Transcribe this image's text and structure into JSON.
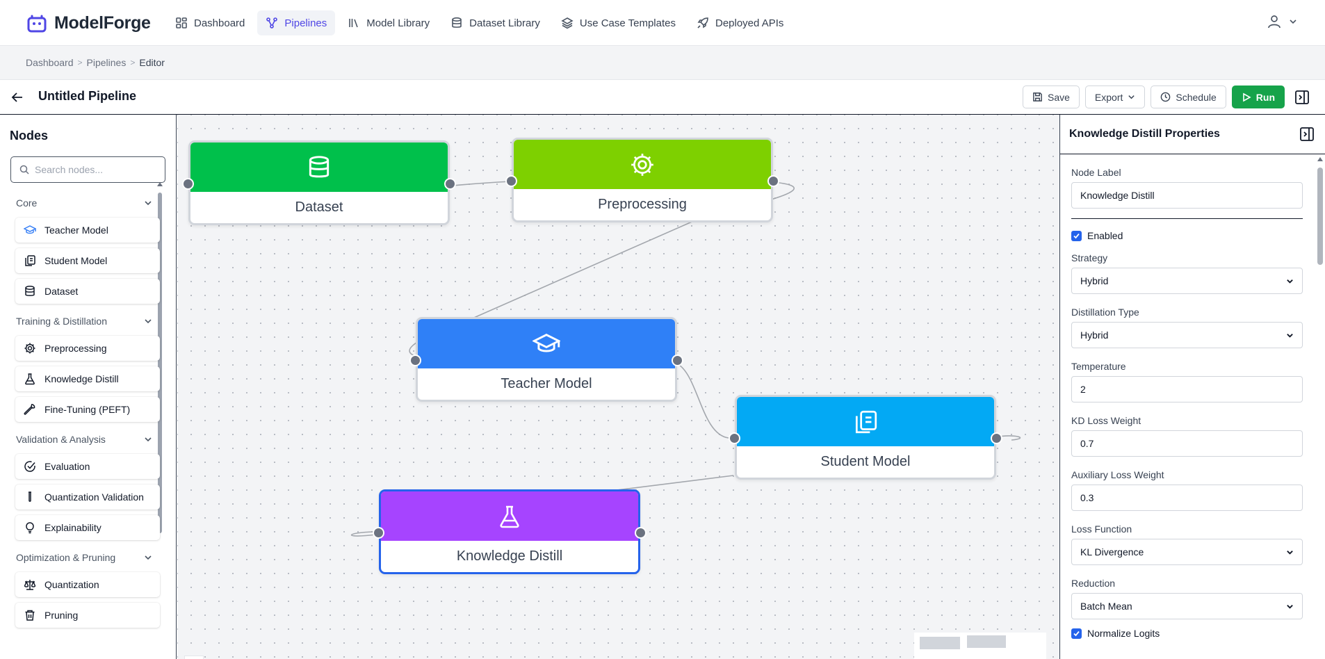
{
  "app": {
    "name": "ModelForge"
  },
  "nav": [
    {
      "label": "Dashboard",
      "icon": "grid-icon"
    },
    {
      "label": "Pipelines",
      "icon": "pipeline-icon",
      "active": true
    },
    {
      "label": "Model Library",
      "icon": "library-icon"
    },
    {
      "label": "Dataset Library",
      "icon": "database-icon"
    },
    {
      "label": "Use Case Templates",
      "icon": "layers-icon"
    },
    {
      "label": "Deployed APIs",
      "icon": "rocket-icon"
    }
  ],
  "breadcrumb": [
    "Dashboard",
    "Pipelines",
    "Editor"
  ],
  "toolbar": {
    "title": "Untitled Pipeline",
    "save": "Save",
    "export": "Export",
    "schedule": "Schedule",
    "run": "Run"
  },
  "sidebar": {
    "title": "Nodes",
    "search_placeholder": "Search nodes...",
    "sections": [
      {
        "name": "Core",
        "items": [
          {
            "label": "Teacher Model",
            "icon": "graduation-cap-icon"
          },
          {
            "label": "Student Model",
            "icon": "copy-icon"
          },
          {
            "label": "Dataset",
            "icon": "database-icon"
          }
        ]
      },
      {
        "name": "Training & Distillation",
        "items": [
          {
            "label": "Preprocessing",
            "icon": "gear-icon"
          },
          {
            "label": "Knowledge Distill",
            "icon": "flask-icon"
          },
          {
            "label": "Fine-Tuning (PEFT)",
            "icon": "wrench-icon"
          }
        ]
      },
      {
        "name": "Validation & Analysis",
        "items": [
          {
            "label": "Evaluation",
            "icon": "check-circle-icon"
          },
          {
            "label": "Quantization Validation",
            "icon": "test-tube-icon"
          },
          {
            "label": "Explainability",
            "icon": "lightbulb-icon"
          }
        ]
      },
      {
        "name": "Optimization & Pruning",
        "items": [
          {
            "label": "Quantization",
            "icon": "scale-icon"
          },
          {
            "label": "Pruning",
            "icon": "trash-icon"
          }
        ]
      }
    ]
  },
  "canvas": {
    "nodes": [
      {
        "label": "Dataset",
        "color": "#00c04b",
        "icon": "database-icon"
      },
      {
        "label": "Preprocessing",
        "color": "#7ed000",
        "icon": "gear-icon"
      },
      {
        "label": "Teacher Model",
        "color": "#2f80f7",
        "icon": "graduation-cap-icon"
      },
      {
        "label": "Student Model",
        "color": "#03a9f4",
        "icon": "copy-icon"
      },
      {
        "label": "Knowledge Distill",
        "color": "#a644ff",
        "icon": "flask-icon",
        "selected": true
      }
    ]
  },
  "properties": {
    "title": "Knowledge Distill Properties",
    "node_label_label": "Node Label",
    "node_label_value": "Knowledge Distill",
    "enabled_label": "Enabled",
    "enabled": true,
    "strategy_label": "Strategy",
    "strategy_value": "Hybrid",
    "distillation_type_label": "Distillation Type",
    "distillation_type_value": "Hybrid",
    "temperature_label": "Temperature",
    "temperature_value": "2",
    "kd_loss_weight_label": "KD Loss Weight",
    "kd_loss_weight_value": "0.7",
    "aux_loss_weight_label": "Auxiliary Loss Weight",
    "aux_loss_weight_value": "0.3",
    "loss_function_label": "Loss Function",
    "loss_function_value": "KL Divergence",
    "reduction_label": "Reduction",
    "reduction_value": "Batch Mean",
    "normalize_logits_label": "Normalize Logits",
    "normalize_logits": true
  }
}
